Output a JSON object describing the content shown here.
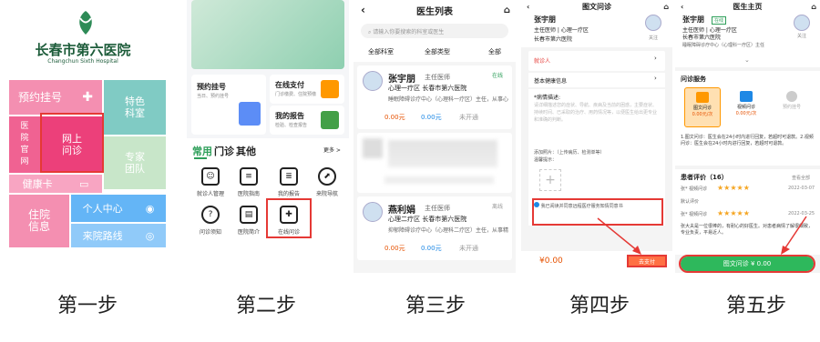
{
  "captions": [
    "第一步",
    "第二步",
    "第三步",
    "第四步",
    "第五步"
  ],
  "p1": {
    "hospital": "长春市第六医院",
    "english": "Changchun Sixth Hospital",
    "tiles": [
      "预约挂号",
      "特色科室",
      "医院官网",
      "网上问诊",
      "专家团队",
      "健康卡",
      "个人中心",
      "住院信息",
      "来院路线"
    ]
  },
  "p2": {
    "card1_title": "预约挂号",
    "card1_sub": "当日、预约挂号",
    "card2_title": "在线支付",
    "card2_sub": "门诊缴费、住院预缴",
    "card3_title": "我的报告",
    "card3_sub": "检验、检查报告",
    "tabs": [
      "常用",
      "门诊",
      "其他"
    ],
    "more": "更多 >",
    "icons": [
      "就诊人管理",
      "医院指南",
      "我的报告",
      "来院导航",
      "问诊须知",
      "医院简介",
      "在线问诊"
    ]
  },
  "p3": {
    "title": "医生列表",
    "search": "请输入你要搜索的科室或医生",
    "filters": [
      "全部科室",
      "全部类型",
      "全部"
    ],
    "d1_name": "张宇朋",
    "d1_title": "主任医师",
    "d1_status": "在线",
    "d1_dept": "心理一疗区  长春市第六医院",
    "d1_desc": "睡眠障碍诊疗中心（心理科一疗区）主任，从事心",
    "d1_p1": "0.00元",
    "d1_p2": "0.00元",
    "d1_p3": "未开通",
    "d3_name": "燕利娟",
    "d3_title": "主任医师",
    "d3_status": "离线",
    "d3_dept": "心理二疗区  长春市第六医院",
    "d3_desc": "抑郁障碍诊疗中心（心理科二疗区）主任，从事精",
    "d3_p1": "0.00元",
    "d3_p2": "0.00元",
    "d3_p3": "未开通"
  },
  "p4": {
    "title": "图文问诊",
    "name": "张宇朋",
    "dept": "主任医师 | 心理一疗区",
    "hosp": "长春市第六医院",
    "follow": "关注",
    "patient_label": "就诊人",
    "health_label": "基本健康信息",
    "desc_label": "*病情描述:",
    "desc_ph": "请详细描述您的症状、导航、疾病及当前的困惑，主要症状、持续时间、已采取的治疗、用药情况等，以便医生给出更专业和准确的判断。",
    "img_label": "添加照片：（上传病历、检测单等）",
    "tip": "温馨提示：",
    "agree": "我已阅读并同意远程医疗服务知情同意书",
    "price": "¥0.00",
    "pay": "去支付"
  },
  "p5": {
    "title": "医生主页",
    "name": "张宇朋",
    "badge": "在线",
    "dept": "主任医师 | 心理一疗区",
    "hosp": "长春市第六医院",
    "desc": "睡眠障碍诊疗中心（心理科一疗区）主任",
    "follow": "关注",
    "svc_title": "问诊服务",
    "svc": [
      "图文问诊",
      "视频问诊",
      "预约挂号"
    ],
    "svc_price": [
      "0.00元/次",
      "0.00元/次",
      ""
    ],
    "note": "1.图文问诊：医生会在24小时内进行回复，若超时可退款。2.视频问诊：医生会在24小时内进行回复，若超时可退款。",
    "eval_title": "患者评价（16）",
    "eval_all": "查看全部",
    "eval_default": "默认评价",
    "r1": "张*  视频问诊",
    "r1_date": "2022-03-07",
    "r2": "张*  视频问诊",
    "r2_date": "2022-03-25",
    "r2_text": "张大夫是一位很棒的，有耐心的好医生。对患者病情了解很细致，专业负责，平易近人。",
    "cta": "图文问诊  ¥ 0.00"
  }
}
